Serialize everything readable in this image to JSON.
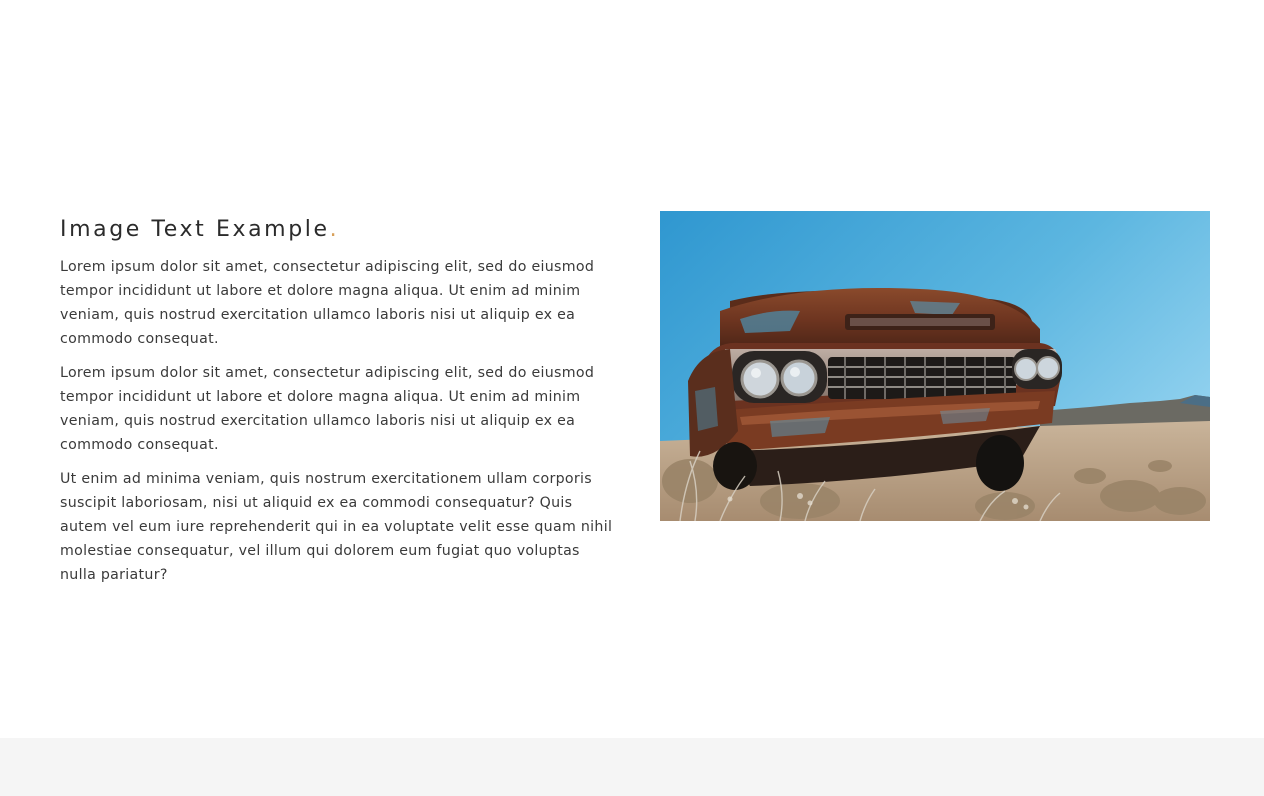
{
  "section": {
    "heading": "Image Text Example",
    "heading_dot": ".",
    "paragraphs": [
      "Lorem ipsum dolor sit amet, consectetur adipiscing elit, sed do eiusmod tempor incididunt ut labore et dolore magna aliqua. Ut enim ad minim veniam, quis nostrud exercitation ullamco laboris nisi ut aliquip ex ea commodo consequat.",
      "Lorem ipsum dolor sit amet, consectetur adipiscing elit, sed do eiusmod tempor incididunt ut labore et dolore magna aliqua. Ut enim ad minim veniam, quis nostrud exercitation ullamco laboris nisi ut aliquip ex ea commodo consequat.",
      "Ut enim ad minima veniam, quis nostrum exercitationem ullam corporis suscipit laboriosam, nisi ut aliquid ex ea commodi consequatur? Quis autem vel eum iure reprehenderit qui in ea voluptate velit esse quam nihil molestiae consequatur, vel illum qui dolorem eum fugiat quo voluptas nulla pariatur?"
    ]
  },
  "image": {
    "subject": "rusty-vintage-car-in-desert"
  },
  "colors": {
    "accent": "#d8a05a",
    "heading": "#2b2b2b",
    "body_text": "#3a3a3a",
    "footer_band": "#f5f5f5",
    "sky": "#3ea3d6",
    "rust": "#7a3b22"
  }
}
